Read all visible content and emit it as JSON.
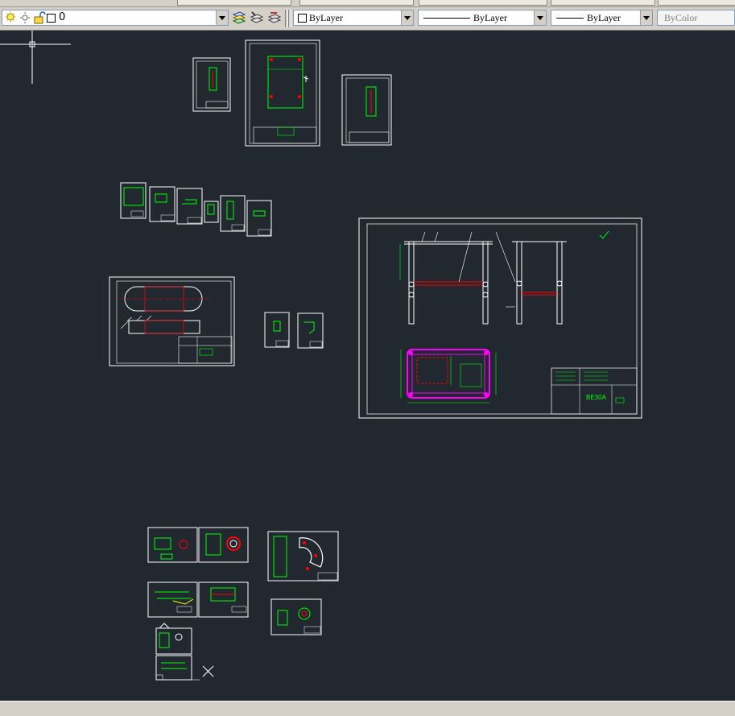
{
  "toolbar": {
    "layer_name": "0",
    "color_value": "ByLayer",
    "linetype_value": "ByLayer",
    "lineweight_value": "ByLayer",
    "plotstyle_value": "ByColor"
  },
  "drawing": {
    "title_block_text": "BE30A"
  },
  "colors": {
    "canvas_bg": "#212830",
    "sheet_line": "#ffffff",
    "geometry_green": "#00ff00",
    "geometry_red": "#ff0000",
    "highlight_magenta": "#ff00ff",
    "toolbar_bg": "#d4d0c8"
  }
}
